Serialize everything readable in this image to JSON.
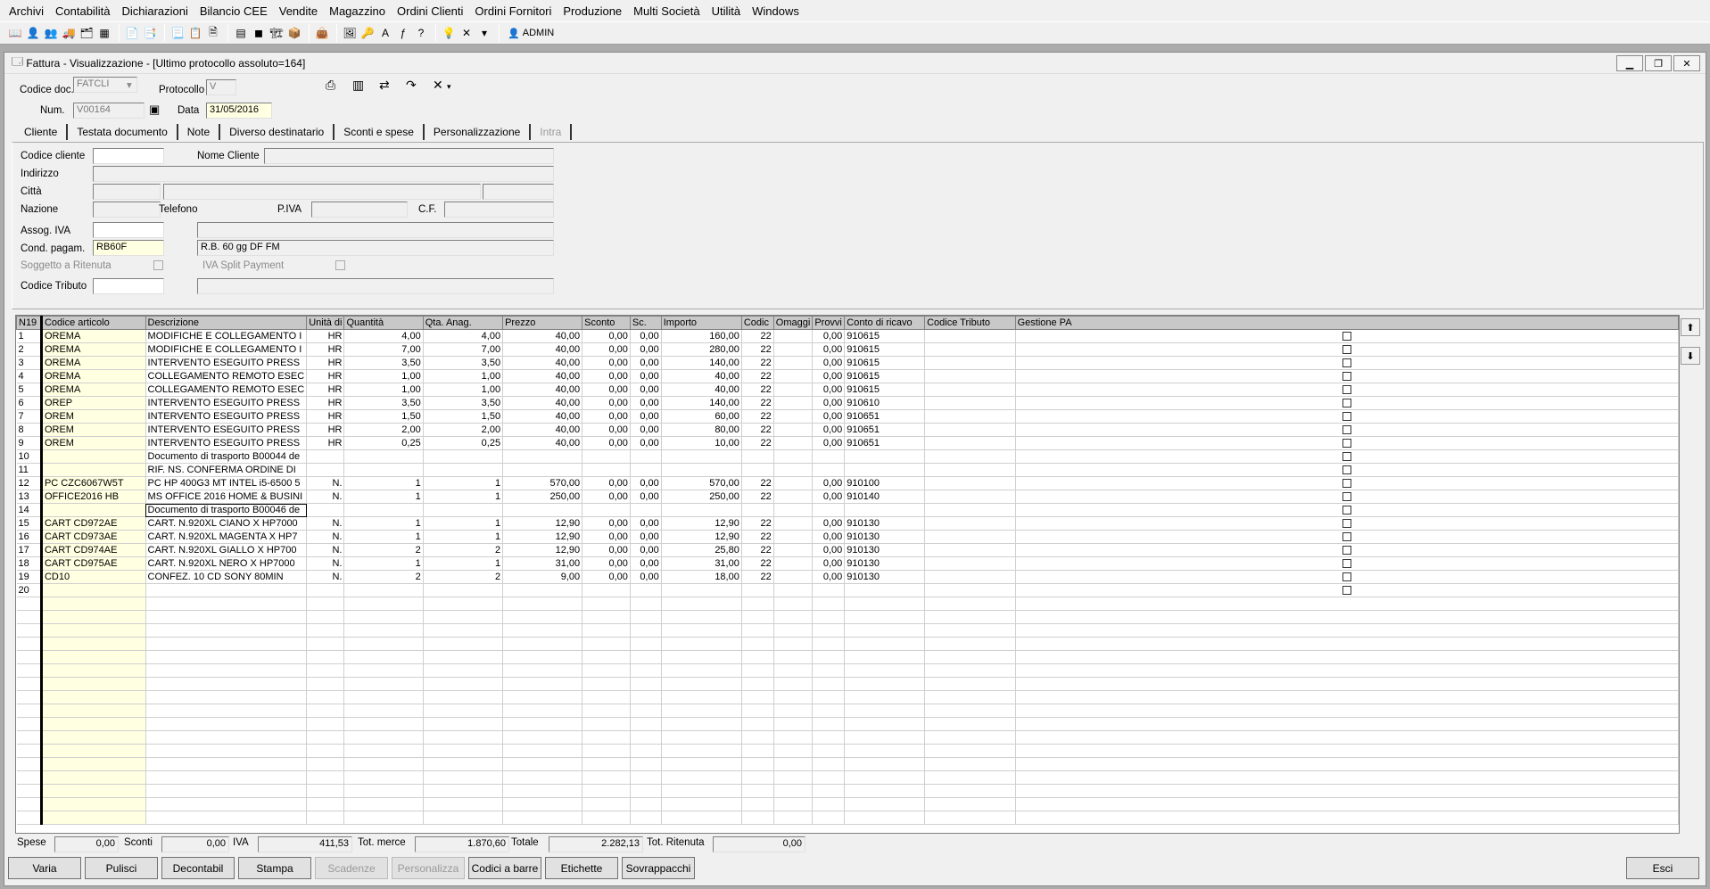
{
  "menu": [
    "Archivi",
    "Contabilità",
    "Dichiarazioni",
    "Bilancio CEE",
    "Vendite",
    "Magazzino",
    "Ordini Clienti",
    "Ordini Fornitori",
    "Produzione",
    "Multi Società",
    "Utilità",
    "Windows"
  ],
  "toolbar": {
    "user": "ADMIN"
  },
  "window": {
    "title": "Fattura - Visualizzazione - [Ultimo protocollo assoluto=164]"
  },
  "header": {
    "codice_doc_label": "Codice doc.",
    "codice_doc": "FATCLI",
    "protocollo_label": "Protocollo",
    "protocollo": "V",
    "num_label": "Num.",
    "num": "V00164",
    "data_label": "Data",
    "data": "31/05/2016"
  },
  "tabs": [
    "Cliente",
    "Testata documento",
    "Note",
    "Diverso destinatario",
    "Sconti e spese",
    "Personalizzazione",
    "Intra"
  ],
  "cliente": {
    "codice_cliente_label": "Codice cliente",
    "nome_cliente_label": "Nome Cliente",
    "indirizzo_label": "Indirizzo",
    "citta_label": "Città",
    "nazione_label": "Nazione",
    "telefono_label": "Telefono",
    "piva_label": "P.IVA",
    "cf_label": "C.F.",
    "assog_iva_label": "Assog. IVA",
    "cond_pagam_label": "Cond. pagam.",
    "cond_pagam": "RB60F",
    "cond_pagam_desc": "R.B. 60 gg DF FM",
    "ritenuta_label": "Soggetto a Ritenuta",
    "split_label": "IVA Split Payment",
    "codice_tributo_label": "Codice Tributo"
  },
  "grid": {
    "columns": [
      "N19",
      "Codice articolo",
      "Descrizione",
      "Unità di",
      "Quantità",
      "Qta. Anag.",
      "Prezzo",
      "Sconto",
      "Sc.",
      "Importo",
      "Codic",
      "Omaggi",
      "Provvi",
      "Conto di ricavo",
      "Codice Tributo",
      "Gestione PA"
    ],
    "rows": [
      [
        "1",
        "OREMA",
        "MODIFICHE E COLLEGAMENTO I",
        "HR",
        "4,00",
        "4,00",
        "40,00",
        "0,00",
        "0,00",
        "160,00",
        "22",
        "",
        "0,00",
        "910615"
      ],
      [
        "2",
        "OREMA",
        "MODIFICHE E COLLEGAMENTO I",
        "HR",
        "7,00",
        "7,00",
        "40,00",
        "0,00",
        "0,00",
        "280,00",
        "22",
        "",
        "0,00",
        "910615"
      ],
      [
        "3",
        "OREMA",
        "INTERVENTO ESEGUITO PRESS",
        "HR",
        "3,50",
        "3,50",
        "40,00",
        "0,00",
        "0,00",
        "140,00",
        "22",
        "",
        "0,00",
        "910615"
      ],
      [
        "4",
        "OREMA",
        "COLLEGAMENTO REMOTO ESEC",
        "HR",
        "1,00",
        "1,00",
        "40,00",
        "0,00",
        "0,00",
        "40,00",
        "22",
        "",
        "0,00",
        "910615"
      ],
      [
        "5",
        "OREMA",
        "COLLEGAMENTO REMOTO ESEC",
        "HR",
        "1,00",
        "1,00",
        "40,00",
        "0,00",
        "0,00",
        "40,00",
        "22",
        "",
        "0,00",
        "910615"
      ],
      [
        "6",
        "OREP",
        "INTERVENTO ESEGUITO PRESS",
        "HR",
        "3,50",
        "3,50",
        "40,00",
        "0,00",
        "0,00",
        "140,00",
        "22",
        "",
        "0,00",
        "910610"
      ],
      [
        "7",
        "OREM",
        "INTERVENTO ESEGUITO PRESS",
        "HR",
        "1,50",
        "1,50",
        "40,00",
        "0,00",
        "0,00",
        "60,00",
        "22",
        "",
        "0,00",
        "910651"
      ],
      [
        "8",
        "OREM",
        "INTERVENTO ESEGUITO PRESS",
        "HR",
        "2,00",
        "2,00",
        "40,00",
        "0,00",
        "0,00",
        "80,00",
        "22",
        "",
        "0,00",
        "910651"
      ],
      [
        "9",
        "OREM",
        "INTERVENTO ESEGUITO PRESS",
        "HR",
        "0,25",
        "0,25",
        "40,00",
        "0,00",
        "0,00",
        "10,00",
        "22",
        "",
        "0,00",
        "910651"
      ],
      [
        "10",
        "",
        "Documento di trasporto B00044 de",
        "",
        "",
        "",
        "",
        "",
        "",
        "",
        "",
        "",
        "",
        ""
      ],
      [
        "11",
        "",
        "RIF. NS. CONFERMA ORDINE  DI",
        "",
        "",
        "",
        "",
        "",
        "",
        "",
        "",
        "",
        "",
        ""
      ],
      [
        "12",
        "PC CZC6067W5T",
        "PC HP 400G3 MT INTEL i5-6500 5",
        "N.",
        "1",
        "1",
        "570,00",
        "0,00",
        "0,00",
        "570,00",
        "22",
        "",
        "0,00",
        "910100"
      ],
      [
        "13",
        "OFFICE2016 HB",
        "MS OFFICE 2016 HOME & BUSINI",
        "N.",
        "1",
        "1",
        "250,00",
        "0,00",
        "0,00",
        "250,00",
        "22",
        "",
        "0,00",
        "910140"
      ],
      [
        "14",
        "",
        "Documento di trasporto B00046 de",
        "",
        "",
        "",
        "",
        "",
        "",
        "",
        "",
        "",
        "",
        ""
      ],
      [
        "15",
        "CART CD972AE",
        "CART. N.920XL CIANO X HP7000",
        "N.",
        "1",
        "1",
        "12,90",
        "0,00",
        "0,00",
        "12,90",
        "22",
        "",
        "0,00",
        "910130"
      ],
      [
        "16",
        "CART CD973AE",
        "CART. N.920XL MAGENTA X HP7",
        "N.",
        "1",
        "1",
        "12,90",
        "0,00",
        "0,00",
        "12,90",
        "22",
        "",
        "0,00",
        "910130"
      ],
      [
        "17",
        "CART CD974AE",
        "CART. N.920XL GIALLO X HP700",
        "N.",
        "2",
        "2",
        "12,90",
        "0,00",
        "0,00",
        "25,80",
        "22",
        "",
        "0,00",
        "910130"
      ],
      [
        "18",
        "CART CD975AE",
        "CART. N.920XL NERO X HP7000",
        "N.",
        "1",
        "1",
        "31,00",
        "0,00",
        "0,00",
        "31,00",
        "22",
        "",
        "0,00",
        "910130"
      ],
      [
        "19",
        "CD10",
        "CONFEZ. 10 CD SONY 80MIN",
        "N.",
        "2",
        "2",
        "9,00",
        "0,00",
        "0,00",
        "18,00",
        "22",
        "",
        "0,00",
        "910130"
      ],
      [
        "20",
        "",
        "",
        "",
        "",
        "",
        "",
        "",
        "",
        "",
        "",
        "",
        "",
        ""
      ]
    ]
  },
  "totals": {
    "spese_label": "Spese",
    "spese": "0,00",
    "sconti_label": "Sconti",
    "sconti": "0,00",
    "iva_label": "IVA",
    "iva": "411,53",
    "tot_merce_label": "Tot. merce",
    "tot_merce": "1.870,60",
    "totale_label": "Totale",
    "totale": "2.282,13",
    "tot_ritenuta_label": "Tot. Ritenuta",
    "tot_ritenuta": "0,00"
  },
  "buttons": [
    "Varia",
    "Pulisci",
    "Decontabil",
    "Stampa",
    "Scadenze",
    "Personalizza",
    "Codici a barre",
    "Etichette",
    "Sovrappacchi",
    "Esci"
  ]
}
